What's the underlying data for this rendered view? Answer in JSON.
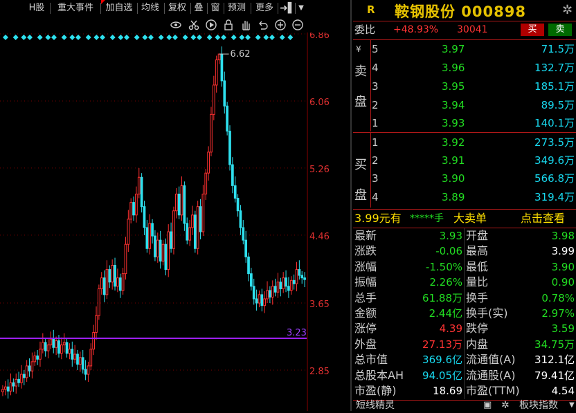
{
  "toolbar": {
    "items": [
      "H股",
      "重大事件",
      "加自选",
      "均线",
      "复权",
      "叠",
      "窗",
      "预测",
      "更多"
    ]
  },
  "chart_tools": {
    "icons": [
      "eye-icon",
      "scissors-icon",
      "play-icon",
      "lock-icon",
      "hand-icon",
      "undo-icon",
      "zoom-in-icon",
      "zoom-out-icon"
    ]
  },
  "chart_data": {
    "type": "candlestick",
    "y_ticks": [
      "6.86",
      "6.06",
      "5.26",
      "4.46",
      "3.65",
      "2.85"
    ],
    "ylim": [
      2.3,
      7.2
    ],
    "annotations": {
      "high_label": "6.62",
      "line_label": "3.23"
    },
    "hline_value": 3.23,
    "colors": {
      "up": "#ff3030",
      "down": "#2ee0ee",
      "hline": "#9d20ff"
    },
    "close_path": [
      2.62,
      2.65,
      2.6,
      2.7,
      2.66,
      2.74,
      2.7,
      2.8,
      2.76,
      2.9,
      2.84,
      2.95,
      3.02,
      2.98,
      3.1,
      3.18,
      3.08,
      3.15,
      3.22,
      3.12,
      3.2,
      3.05,
      3.15,
      3.18,
      3.05,
      3.1,
      2.98,
      3.04,
      2.92,
      3.0,
      2.86,
      2.8,
      2.9,
      3.1,
      3.3,
      3.5,
      3.82,
      3.95,
      3.75,
      4.05,
      3.9,
      4.1,
      3.85,
      3.95,
      3.8,
      4.0,
      4.35,
      4.65,
      4.85,
      4.7,
      4.95,
      5.15,
      4.8,
      4.55,
      4.3,
      4.6,
      4.45,
      4.2,
      4.4,
      4.15,
      4.35,
      4.05,
      4.5,
      4.3,
      4.75,
      4.95,
      4.7,
      5.05,
      4.6,
      4.4,
      4.55,
      4.7,
      4.3,
      4.8,
      4.5,
      4.95,
      5.2,
      5.45,
      5.9,
      6.25,
      6.55,
      6.62,
      6.3,
      6.0,
      5.7,
      5.3,
      5.05,
      4.9,
      4.75,
      4.55,
      4.4,
      4.2,
      4.0,
      3.85,
      3.7,
      3.65,
      3.75,
      3.62,
      3.7,
      3.8,
      3.72,
      3.85,
      3.78,
      3.9,
      3.82,
      3.95,
      3.85,
      3.8,
      3.92,
      3.88,
      4.05,
      3.98,
      3.95,
      3.93
    ],
    "diamond_markers_count": 36
  },
  "quote": {
    "r_label": "R",
    "title": "鞍钢股份 000898",
    "weibi_label": "委比",
    "weibi_value": "+48.93%",
    "weicha_value": "30041",
    "buy_button": "买",
    "sell_button": "卖",
    "ask_label_chars": [
      "¥",
      "卖",
      "盘"
    ],
    "bid_label_chars": [
      "买",
      "盘"
    ],
    "asks": [
      {
        "level": "5",
        "price": "3.97",
        "vol": "71.5万"
      },
      {
        "level": "4",
        "price": "3.96",
        "vol": "132.7万"
      },
      {
        "level": "3",
        "price": "3.95",
        "vol": "185.1万"
      },
      {
        "level": "2",
        "price": "3.94",
        "vol": "89.5万"
      },
      {
        "level": "1",
        "price": "3.93",
        "vol": "140.1万"
      }
    ],
    "bids": [
      {
        "level": "1",
        "price": "3.92",
        "vol": "273.5万"
      },
      {
        "level": "2",
        "price": "3.91",
        "vol": "349.6万"
      },
      {
        "level": "3",
        "price": "3.90",
        "vol": "566.8万"
      },
      {
        "level": "4",
        "price": "3.89",
        "vol": "319.4万"
      }
    ],
    "bigorder": {
      "price": "3.99元有",
      "stars": "*****手",
      "text": "大卖单",
      "link": "点击查看"
    },
    "stats": [
      {
        "l1": "最新",
        "v1": "3.93",
        "c1": "grn",
        "l2": "开盘",
        "v2": "3.98",
        "c2": "grn"
      },
      {
        "l1": "涨跌",
        "v1": "-0.06",
        "c1": "grn",
        "l2": "最高",
        "v2": "3.99",
        "c2": "wht"
      },
      {
        "l1": "涨幅",
        "v1": "-1.50%",
        "c1": "grn",
        "l2": "最低",
        "v2": "3.90",
        "c2": "grn"
      },
      {
        "l1": "振幅",
        "v1": "2.26%",
        "c1": "grn",
        "l2": "量比",
        "v2": "0.90",
        "c2": "grn"
      },
      {
        "l1": "总手",
        "v1": "61.88万",
        "c1": "grn",
        "l2": "换手",
        "v2": "0.78%",
        "c2": "grn"
      },
      {
        "l1": "金额",
        "v1": "2.44亿",
        "c1": "grn",
        "l2": "换手(实)",
        "v2": "2.97%",
        "c2": "grn"
      },
      {
        "l1": "涨停",
        "v1": "4.39",
        "c1": "red",
        "l2": "跌停",
        "v2": "3.59",
        "c2": "grn"
      },
      {
        "l1": "外盘",
        "v1": "27.13万",
        "c1": "red",
        "l2": "内盘",
        "v2": "34.75万",
        "c2": "grn"
      },
      {
        "l1": "总市值",
        "v1": "369.6亿",
        "c1": "cyn",
        "l2": "流通值(A)",
        "v2": "312.1亿",
        "c2": "wht"
      },
      {
        "l1": "总股本AH",
        "v1": "94.05亿",
        "c1": "cyn",
        "l2": "流通股(A)",
        "v2": "79.41亿",
        "c2": "wht"
      },
      {
        "l1": "市盈(静)",
        "v1": "18.69",
        "c1": "wht",
        "l2": "市盈(TTM)",
        "v2": "4.54",
        "c2": "wht"
      }
    ],
    "footer_left": "短线精灵",
    "footer_right": "板块指数"
  }
}
